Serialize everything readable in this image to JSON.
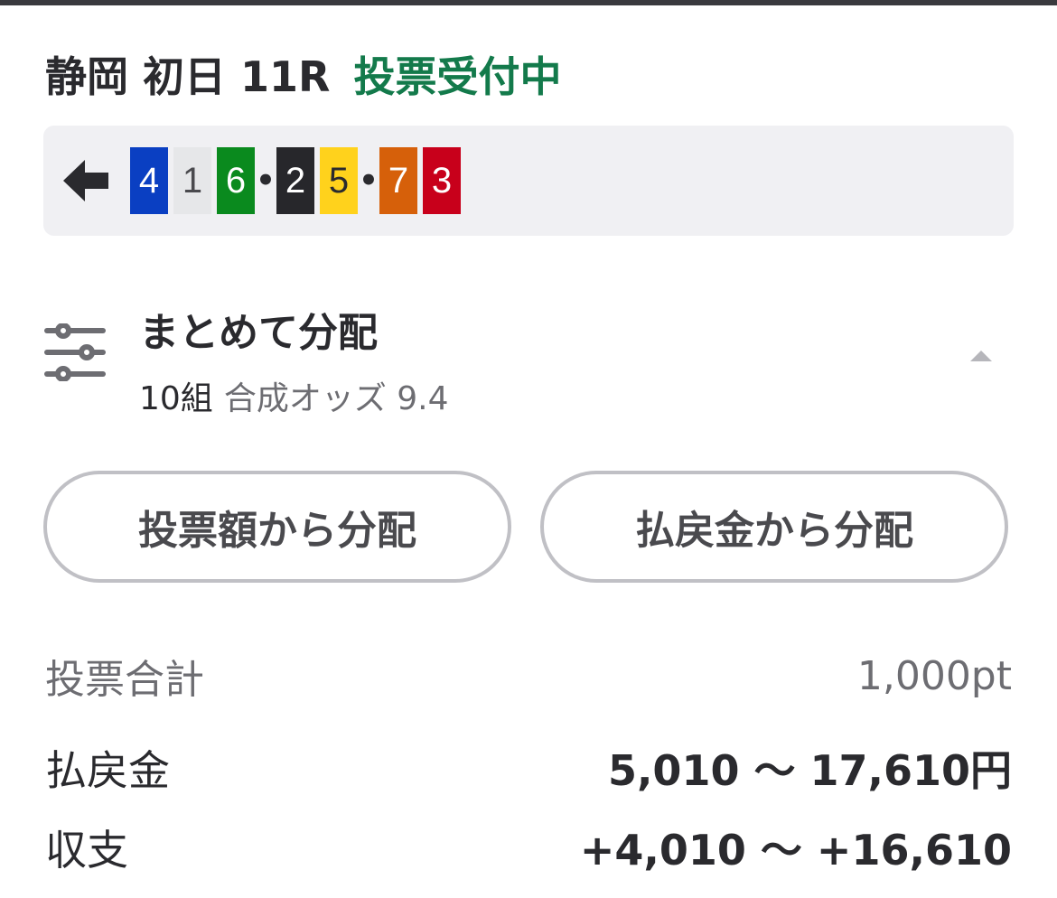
{
  "header": {
    "race_title": "静岡 初日 11R",
    "status": "投票受付中"
  },
  "combination": {
    "chips": [
      {
        "number": "4",
        "color": "#0a3fc2"
      },
      {
        "number": "1",
        "color": "#e6e7e9"
      },
      {
        "number": "6",
        "color": "#0a8a1e"
      },
      {
        "number": "•",
        "separator": true
      },
      {
        "number": "2",
        "color": "#27272b"
      },
      {
        "number": "5",
        "color": "#ffd21c"
      },
      {
        "number": "•",
        "separator": true
      },
      {
        "number": "7",
        "color": "#d6600a"
      },
      {
        "number": "3",
        "color": "#c8001b"
      }
    ]
  },
  "distribution": {
    "title": "まとめて分配",
    "count": "10組",
    "odds": "合成オッズ 9.4"
  },
  "buttons": {
    "by_amount": "投票額から分配",
    "by_payout": "払戻金から分配"
  },
  "summary": {
    "total_label": "投票合計",
    "total_value": "1,000pt",
    "payout_label": "払戻金",
    "payout_value": "5,010 〜 17,610円",
    "balance_label": "収支",
    "balance_value": "+4,010 〜 +16,610"
  },
  "colors": {
    "accent_green": "#137a4b",
    "text_primary": "#2a2a2e",
    "text_secondary": "#6d6d72",
    "panel_bg": "#f0f0f3"
  }
}
